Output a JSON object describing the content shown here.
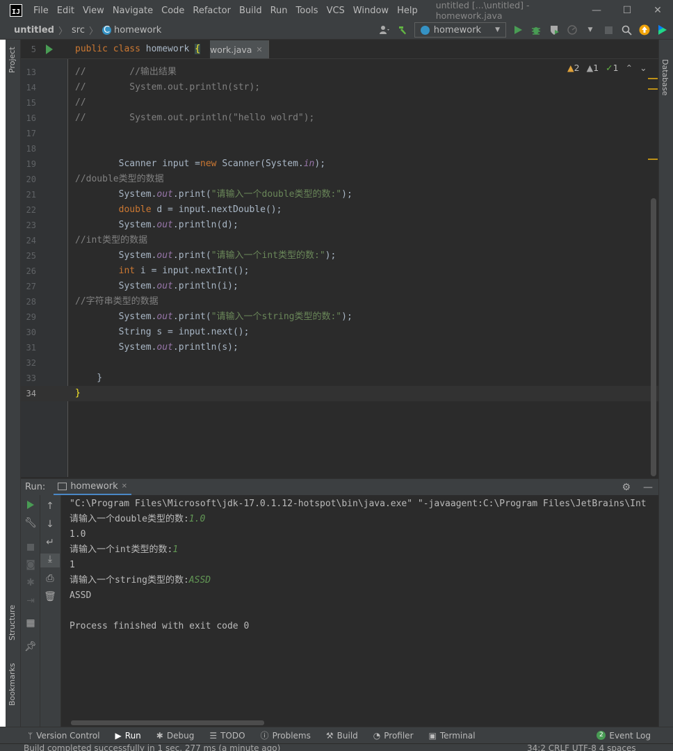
{
  "window": {
    "logo_text": "IJ",
    "menu": [
      "File",
      "Edit",
      "View",
      "Navigate",
      "Code",
      "Refactor",
      "Build",
      "Run",
      "Tools",
      "VCS",
      "Window",
      "Help"
    ],
    "title": "untitled [...\\untitled] - homework.java",
    "controls": {
      "minimize": "—",
      "maximize": "☐",
      "close": "✕"
    }
  },
  "navbar": {
    "project": "untitled",
    "folder": "src",
    "file": "homework",
    "run_config": "homework"
  },
  "left_tools": {
    "project": "Project",
    "structure": "Structure",
    "bookmarks": "Bookmarks"
  },
  "right_tools": {
    "database": "Database"
  },
  "editor": {
    "tab_fragment": "work.java",
    "inspection": {
      "warnings": "2",
      "weak_warnings": "1",
      "typos": "1"
    },
    "sticky": {
      "ln": "5"
    },
    "lines": [
      {
        "ln": "13"
      },
      {
        "ln": "14"
      },
      {
        "ln": "15"
      },
      {
        "ln": "16"
      },
      {
        "ln": "17"
      },
      {
        "ln": "18"
      },
      {
        "ln": "19"
      },
      {
        "ln": "20"
      },
      {
        "ln": "21"
      },
      {
        "ln": "22"
      },
      {
        "ln": "23"
      },
      {
        "ln": "24"
      },
      {
        "ln": "25"
      },
      {
        "ln": "26"
      },
      {
        "ln": "27"
      },
      {
        "ln": "28"
      },
      {
        "ln": "29"
      },
      {
        "ln": "30"
      },
      {
        "ln": "31"
      },
      {
        "ln": "32"
      },
      {
        "ln": "33"
      },
      {
        "ln": "34"
      }
    ]
  },
  "code": {
    "sticky_kw": "public class ",
    "sticky_name": "homework ",
    "sticky_brace": "{",
    "l13": "//        //输出结果",
    "l14": "//        System.out.println(str);",
    "l15": "//",
    "l16": "//        System.out.println(\"hello wolrd\");",
    "l19a": "        Scanner input =",
    "l19kw": "new",
    "l19b": " Scanner(System.",
    "l19f": "in",
    "l19c": ");",
    "l20": "//double类型的数据",
    "l21a": "        System.",
    "l21f": "out",
    "l21b": ".print(",
    "l21s": "\"请输入一个double类型的数:\"",
    "l21c": ");",
    "l22kw": "        double",
    "l22b": " d = input.nextDouble();",
    "l23a": "        System.",
    "l23f": "out",
    "l23b": ".println(d);",
    "l24": "//int类型的数据",
    "l25a": "        System.",
    "l25f": "out",
    "l25b": ".print(",
    "l25s": "\"请输入一个int类型的数:\"",
    "l25c": ");",
    "l26kw": "        int",
    "l26b": " i = input.nextInt();",
    "l27a": "        System.",
    "l27f": "out",
    "l27b": ".println(i);",
    "l28": "//字符串类型的数据",
    "l29a": "        System.",
    "l29f": "out",
    "l29b": ".print(",
    "l29s": "\"请输入一个string类型的数:\"",
    "l29c": ");",
    "l30": "        String s = input.next();",
    "l31a": "        System.",
    "l31f": "out",
    "l31b": ".println(s);",
    "l33": "    }",
    "l34": "}"
  },
  "run_panel": {
    "title": "Run:",
    "tab": "homework",
    "console": {
      "cmd": "\"C:\\Program Files\\Microsoft\\jdk-17.0.1.12-hotspot\\bin\\java.exe\" \"-javaagent:C:\\Program Files\\JetBrains\\Int",
      "p1": "请输入一个double类型的数:",
      "in1": "1.0",
      "o1": "1.0",
      "p2": "请输入一个int类型的数:",
      "in2": "1",
      "o2": "1",
      "p3": "请输入一个string类型的数:",
      "in3": "ASSD",
      "o3": "ASSD",
      "exit": "Process finished with exit code 0"
    }
  },
  "bottom_tools": {
    "version_control": "Version Control",
    "run": "Run",
    "debug": "Debug",
    "todo": "TODO",
    "problems": "Problems",
    "build": "Build",
    "profiler": "Profiler",
    "terminal": "Terminal",
    "event_count": "2",
    "event_log": "Event Log"
  },
  "status": {
    "message": "Build completed successfully in 1 sec, 277 ms (a minute ago)",
    "right": "34:2   CRLF   UTF-8   4 spaces"
  },
  "colors": {
    "background": "#2b2b2b",
    "chrome": "#3c3f41",
    "keyword": "#cc7832",
    "string": "#6a8759",
    "comment": "#808080",
    "field": "#9876aa",
    "run_green": "#499c54"
  }
}
